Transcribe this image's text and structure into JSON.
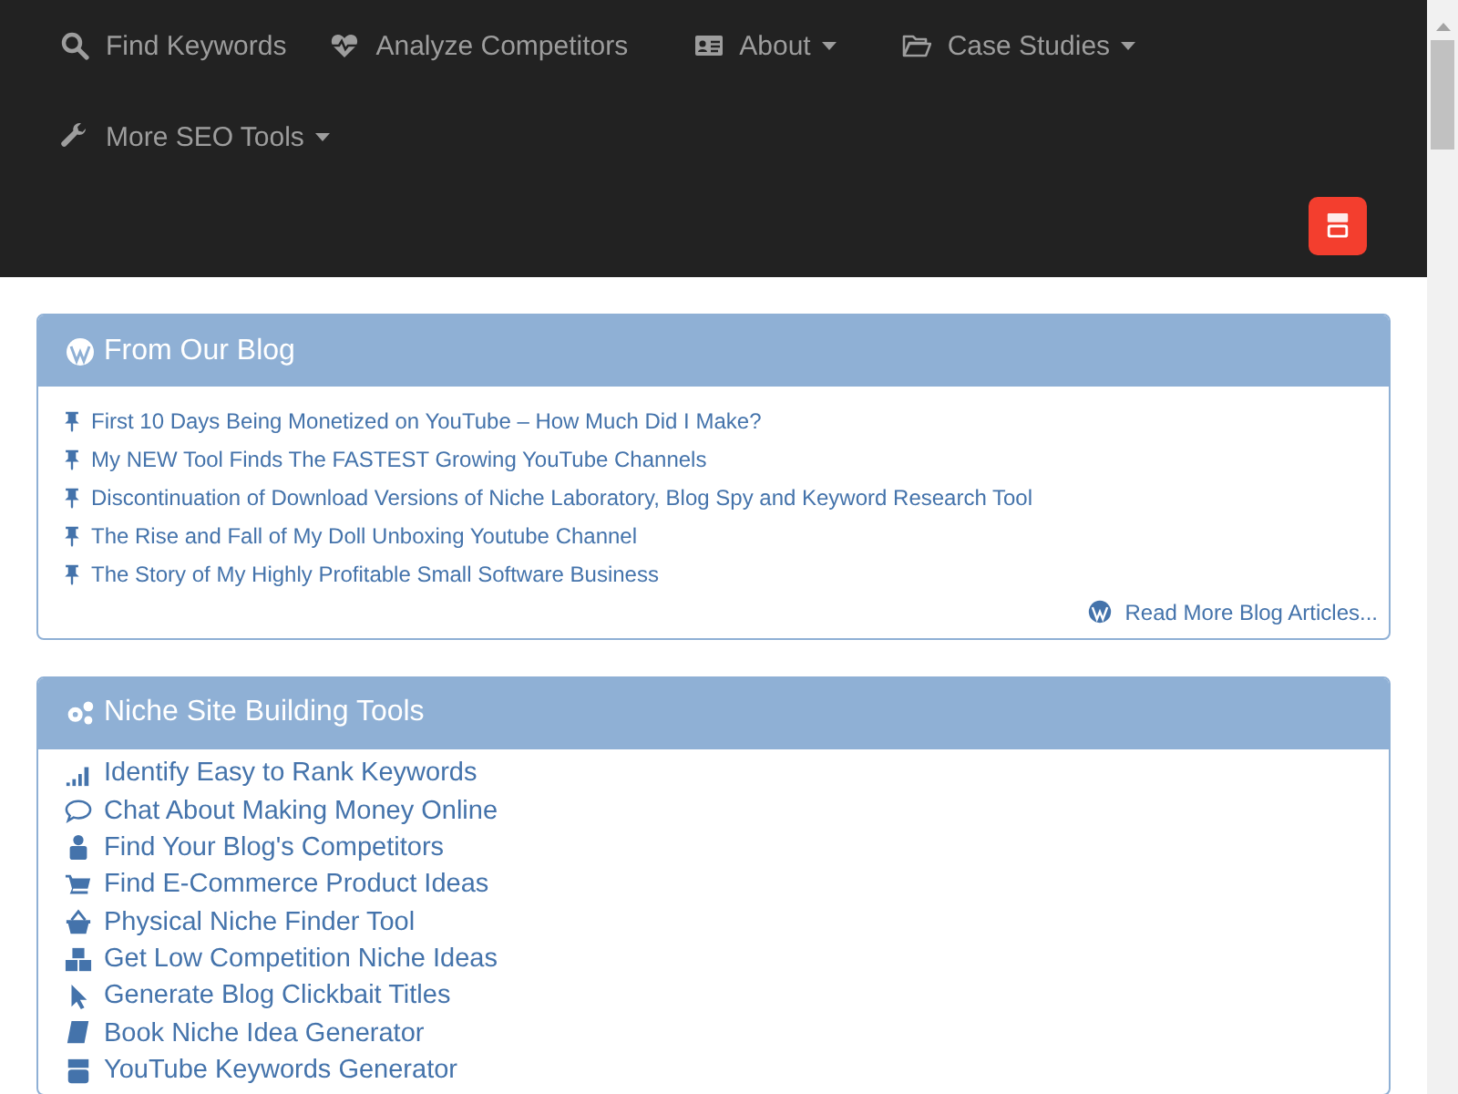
{
  "nav": {
    "items": [
      {
        "label": "Find Keywords",
        "has_menu": false
      },
      {
        "label": "Analyze Competitors",
        "has_menu": false
      },
      {
        "label": "About",
        "has_menu": true
      },
      {
        "label": "Case Studies",
        "has_menu": true
      },
      {
        "label": "More SEO Tools",
        "has_menu": true
      }
    ]
  },
  "blog": {
    "title": "From Our Blog",
    "posts": [
      "First 10 Days Being Monetized on YouTube – How Much Did I Make?",
      "My NEW Tool Finds The FASTEST Growing YouTube Channels",
      "Discontinuation of Download Versions of Niche Laboratory, Blog Spy and Keyword Research Tool",
      "The Rise and Fall of My Doll Unboxing Youtube Channel",
      "The Story of My Highly Profitable Small Software Business"
    ],
    "more_link": "Read More Blog Articles..."
  },
  "tools": {
    "title": "Niche Site Building Tools",
    "items": [
      "Identify Easy to Rank Keywords",
      "Chat About Making Money Online",
      "Find Your Blog's Competitors",
      "Find E-Commerce Product Ideas",
      "Physical Niche Finder Tool",
      "Get Low Competition Niche Ideas",
      "Generate Blog Clickbait Titles",
      "Book Niche Idea Generator",
      "YouTube Keywords Generator"
    ]
  }
}
